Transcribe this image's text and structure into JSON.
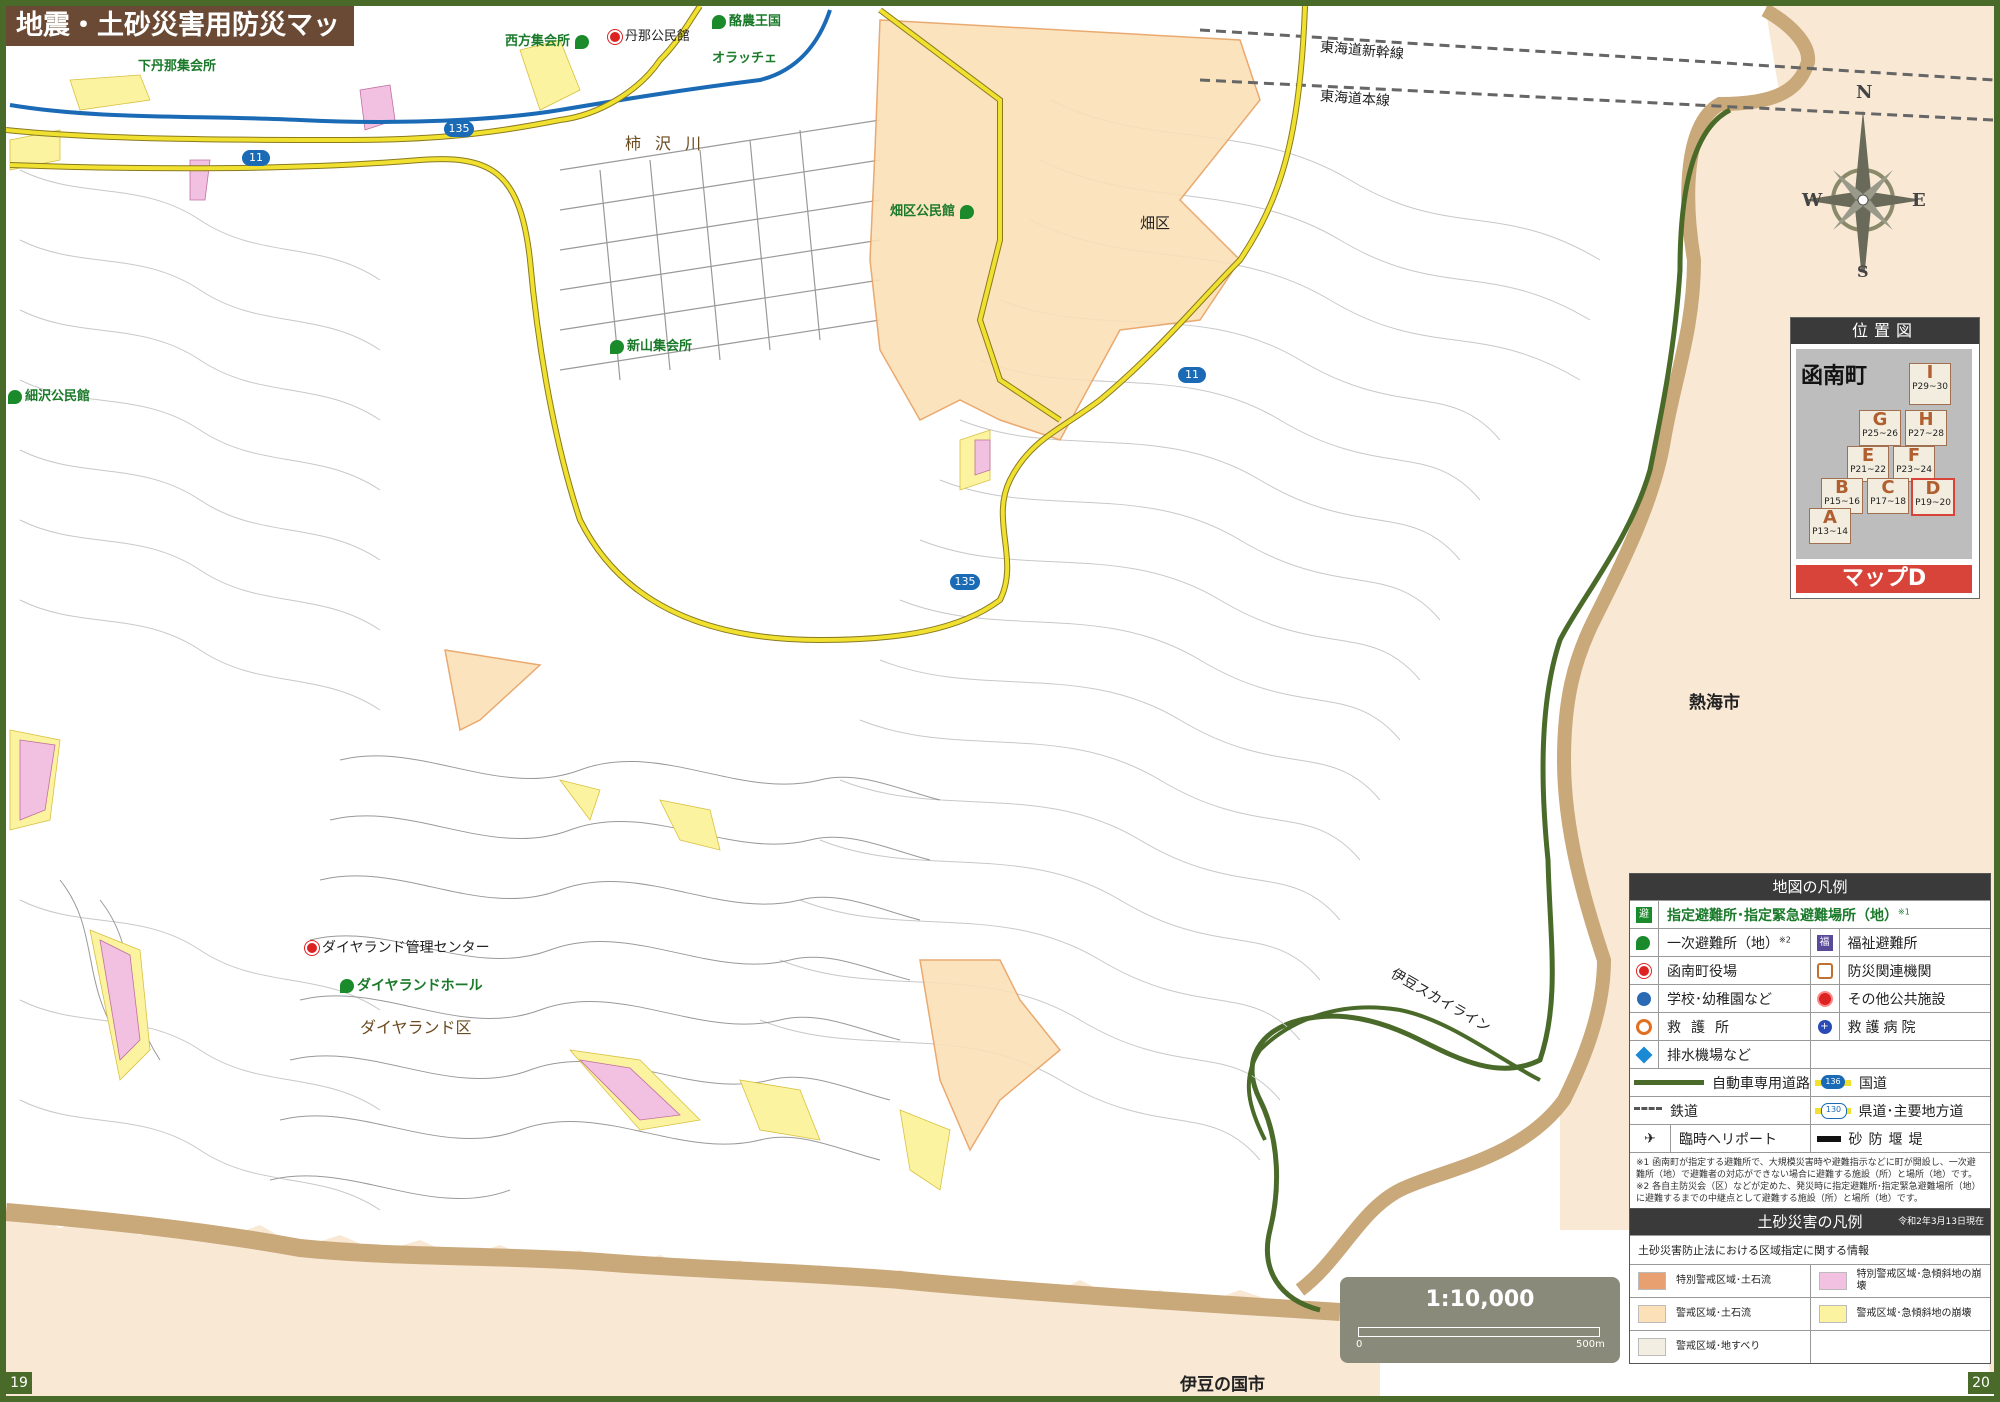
{
  "title": "地震・土砂災害用防災マップ",
  "page_left": "19",
  "page_right": "20",
  "places": {
    "nishikata": "西方集会所",
    "tanna": "丹那公民館",
    "rakuno": "酪農王国",
    "orachi": "オラッチェ",
    "shimotanna": "下丹那集会所",
    "kakisawa": "柿沢川",
    "hatakeku_hall": "畑区公民館",
    "hatakeku": "畑区",
    "shinyama": "新山集会所",
    "hosozawa": "細沢公民館",
    "dialand_center": "ダイヤランド管理センター",
    "dialand_hall": "ダイヤランドホール",
    "dialand_ku": "ダイヤランド区",
    "shinkansen": "東海道新幹線",
    "honsen": "東海道本線",
    "skyline": "伊豆スカイライン",
    "atami": "熱海市",
    "izunokuni": "伊豆の国市"
  },
  "road_badges": {
    "r11a": "11",
    "r135a": "135",
    "r11b": "11",
    "r135b": "135"
  },
  "compass": {
    "n": "N",
    "s": "S",
    "e": "E",
    "w": "W"
  },
  "locator": {
    "header": "位置図",
    "town": "函南町",
    "button": "マップD",
    "sheets": [
      {
        "letter": "I",
        "pages": "P29~30"
      },
      {
        "letter": "G",
        "pages": "P25~26"
      },
      {
        "letter": "H",
        "pages": "P27~28"
      },
      {
        "letter": "E",
        "pages": "P21~22"
      },
      {
        "letter": "F",
        "pages": "P23~24"
      },
      {
        "letter": "B",
        "pages": "P15~16"
      },
      {
        "letter": "C",
        "pages": "P17~18"
      },
      {
        "letter": "D",
        "pages": "P19~20"
      },
      {
        "letter": "A",
        "pages": "P13~14"
      }
    ]
  },
  "legend": {
    "header": "地図の凡例",
    "designated": "指定避難所･指定緊急避難場所（地）",
    "designated_note": "※1",
    "primary": "一次避難所（地）",
    "primary_note": "※2",
    "welfare": "福祉避難所",
    "town_office": "函南町役場",
    "disaster_org": "防災関連機関",
    "school": "学校･幼稚園など",
    "public": "その他公共施設",
    "rescue": "救護所",
    "hospital": "救護病院",
    "pump": "排水機場など",
    "expressway": "自動車専用道路",
    "national": "国道",
    "national_badge": "136",
    "railway": "鉄道",
    "prefectural": "県道･主要地方道",
    "prefectural_badge": "130",
    "heliport": "臨時ヘリポート",
    "sabo": "砂防堰堤",
    "note1": "※1 函南町が指定する避難所で、大規模災害時や避難指示などに町が開設し、一次避難所（地）で避難者の対応ができない場合に避難する施設（所）と場所（地）です。",
    "note2": "※2 各自主防災会（区）などが定めた、発災時に指定避難所･指定緊急避難場所（地）に避難するまでの中継点として避難する施設（所）と場所（地）です。"
  },
  "sediment_legend": {
    "header": "土砂災害の凡例",
    "date": "令和2年3月13日現在",
    "subtitle": "土砂災害防止法における区域指定に関する情報",
    "items": [
      {
        "label": "特別警戒区域･土石流",
        "color": "#e8a070"
      },
      {
        "label": "特別警戒区域･急傾斜地の崩壊",
        "color": "#f2c0e0"
      },
      {
        "label": "警戒区域･土石流",
        "color": "#fbe0b8"
      },
      {
        "label": "警戒区域･急傾斜地の崩壊",
        "color": "#fbf3a0"
      },
      {
        "label": "警戒区域･地すべり",
        "color": "#f3eee2"
      }
    ]
  },
  "scale": {
    "ratio": "1:10,000",
    "zero": "0",
    "max": "500m"
  }
}
